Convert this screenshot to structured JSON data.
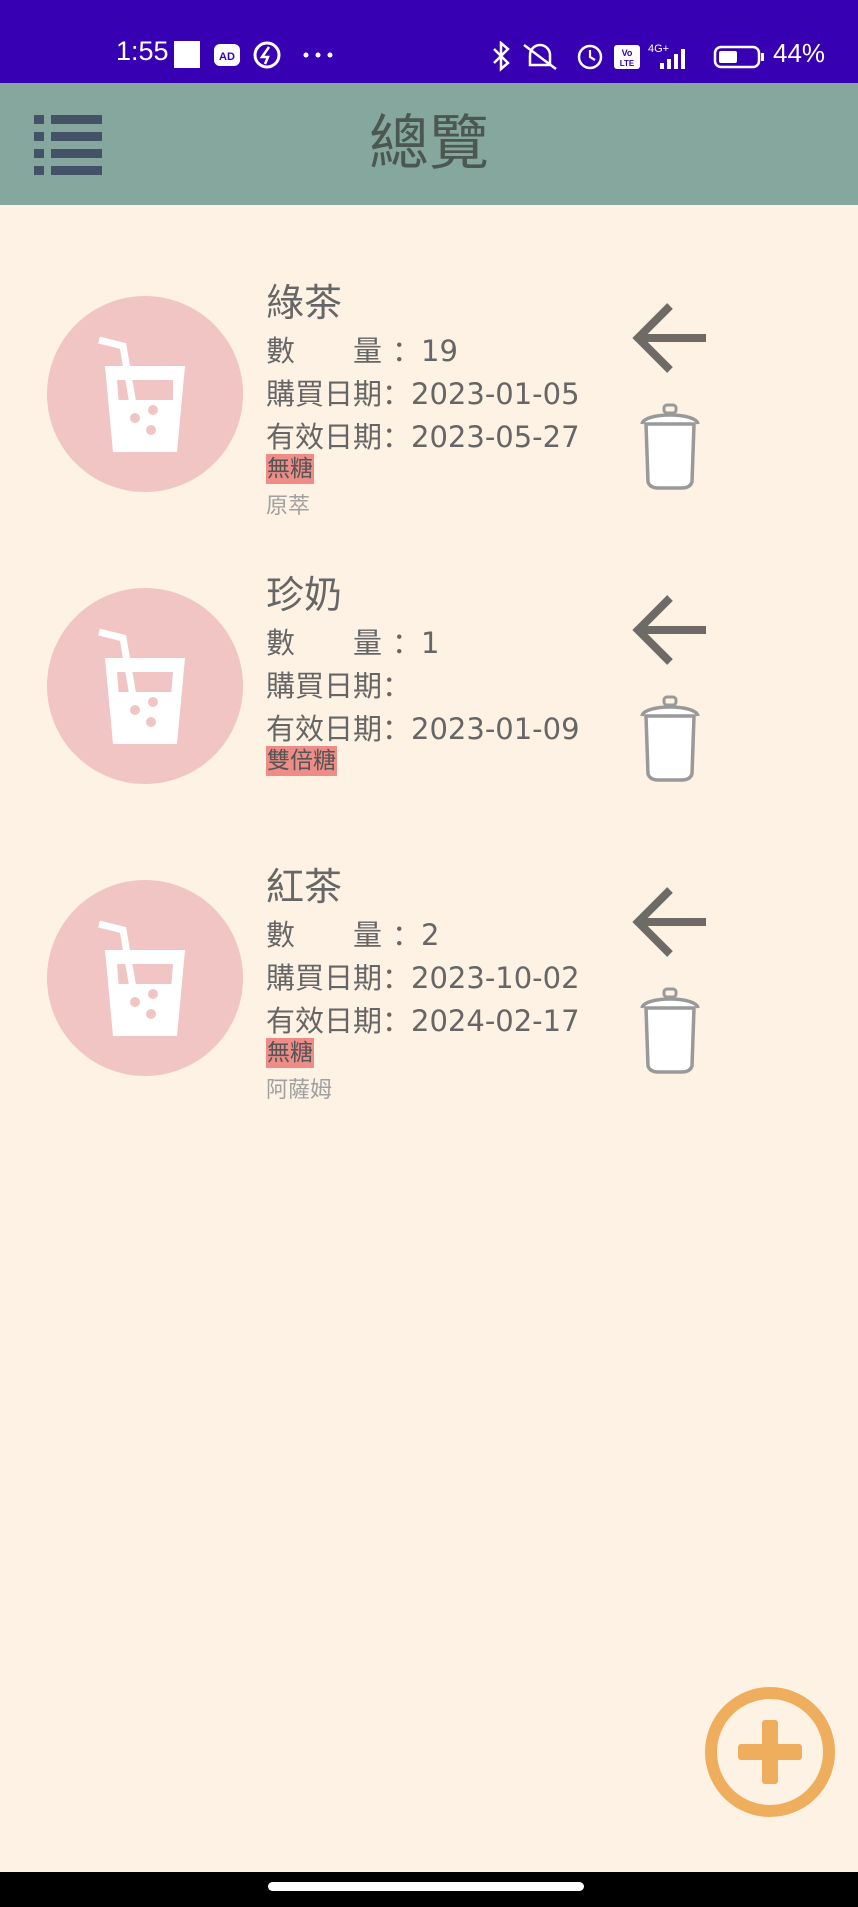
{
  "status_bar": {
    "time": "1:55",
    "battery_text": "44%",
    "network": "4G+",
    "icons": [
      "square-icon",
      "ad-icon",
      "lightning-icon",
      "more-icon",
      "bluetooth-icon",
      "mute-icon",
      "alarm-icon",
      "volte-icon",
      "signal-icon",
      "battery-icon"
    ]
  },
  "app_bar": {
    "title": "總覽",
    "menu_icon": "menu-list-icon"
  },
  "labels": {
    "quantity_a": "數",
    "quantity_b": "量",
    "purchase_date": "購買日期：",
    "expiry_date": "有效日期："
  },
  "items": [
    {
      "name": "綠茶",
      "quantity": "19",
      "purchase_date": "2023-01-05",
      "expiry_date": "2023-05-27",
      "sugar": "無糖",
      "note": "原萃"
    },
    {
      "name": "珍奶",
      "quantity": "1",
      "purchase_date": "",
      "expiry_date": "2023-01-09",
      "sugar": "雙倍糖",
      "note": ""
    },
    {
      "name": "紅茶",
      "quantity": "2",
      "purchase_date": "2023-10-02",
      "expiry_date": "2024-02-17",
      "sugar": "無糖",
      "note": "阿薩姆"
    }
  ],
  "colors": {
    "status_bar": "#3700b3",
    "app_bar": "#86a79d",
    "background": "#fdf2e3",
    "avatar": "#f0c5c3",
    "tag": "#ee8d87",
    "fab": "#efad5e",
    "icon_gray": "#6e6a65"
  }
}
